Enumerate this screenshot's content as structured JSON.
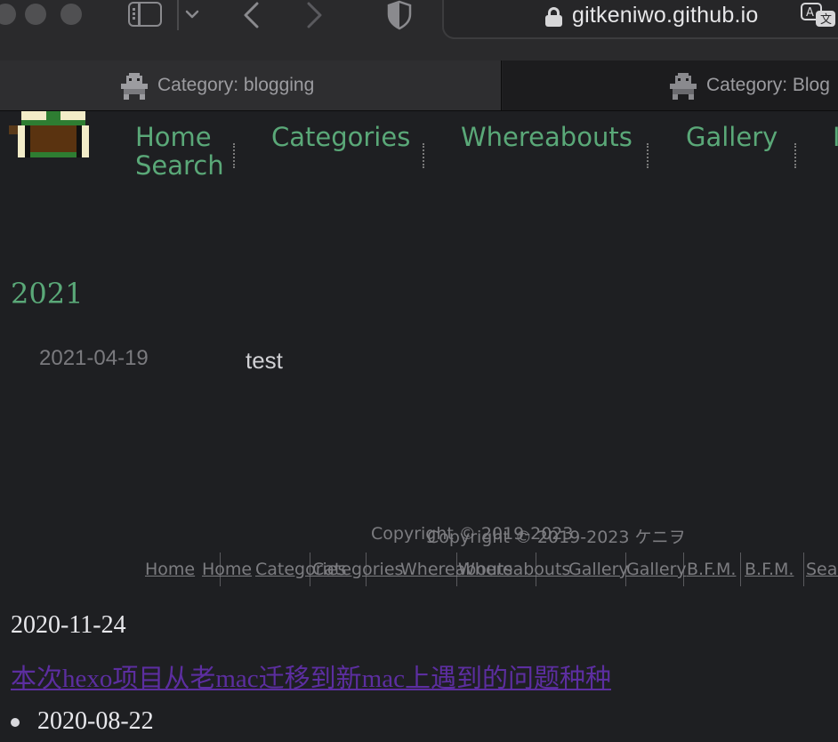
{
  "browser": {
    "url": "gitkeniwo.github.io",
    "tabs": [
      {
        "title": "Category: blogging",
        "active": true
      },
      {
        "title": "Category: Blog",
        "active": false
      }
    ]
  },
  "site": {
    "nav": [
      "Home",
      "Categories",
      "Whereabouts",
      "Gallery",
      "Search"
    ],
    "accent_color": "#5aa878"
  },
  "archive": {
    "year": "2021",
    "posts": [
      {
        "date": "2021-04-19",
        "title": "test"
      }
    ]
  },
  "footer": {
    "copyright_1": "Copyright © 2019-2023",
    "copyright_2": "Copyright © 2019-2023 ケニヲ",
    "links": [
      "Home",
      "Home",
      "Categories",
      "Categories",
      "Whereabouts",
      "Whereabouts",
      "Gallery",
      "Gallery",
      "B.F.M.",
      "B.F.M.",
      "Search"
    ]
  },
  "unstyled": {
    "date": "2020-11-24",
    "link": "本次hexo项目从老mac迁移到新mac上遇到的问题种种",
    "list_date": "2020-08-22",
    "link_color": "#5c2ea0"
  }
}
